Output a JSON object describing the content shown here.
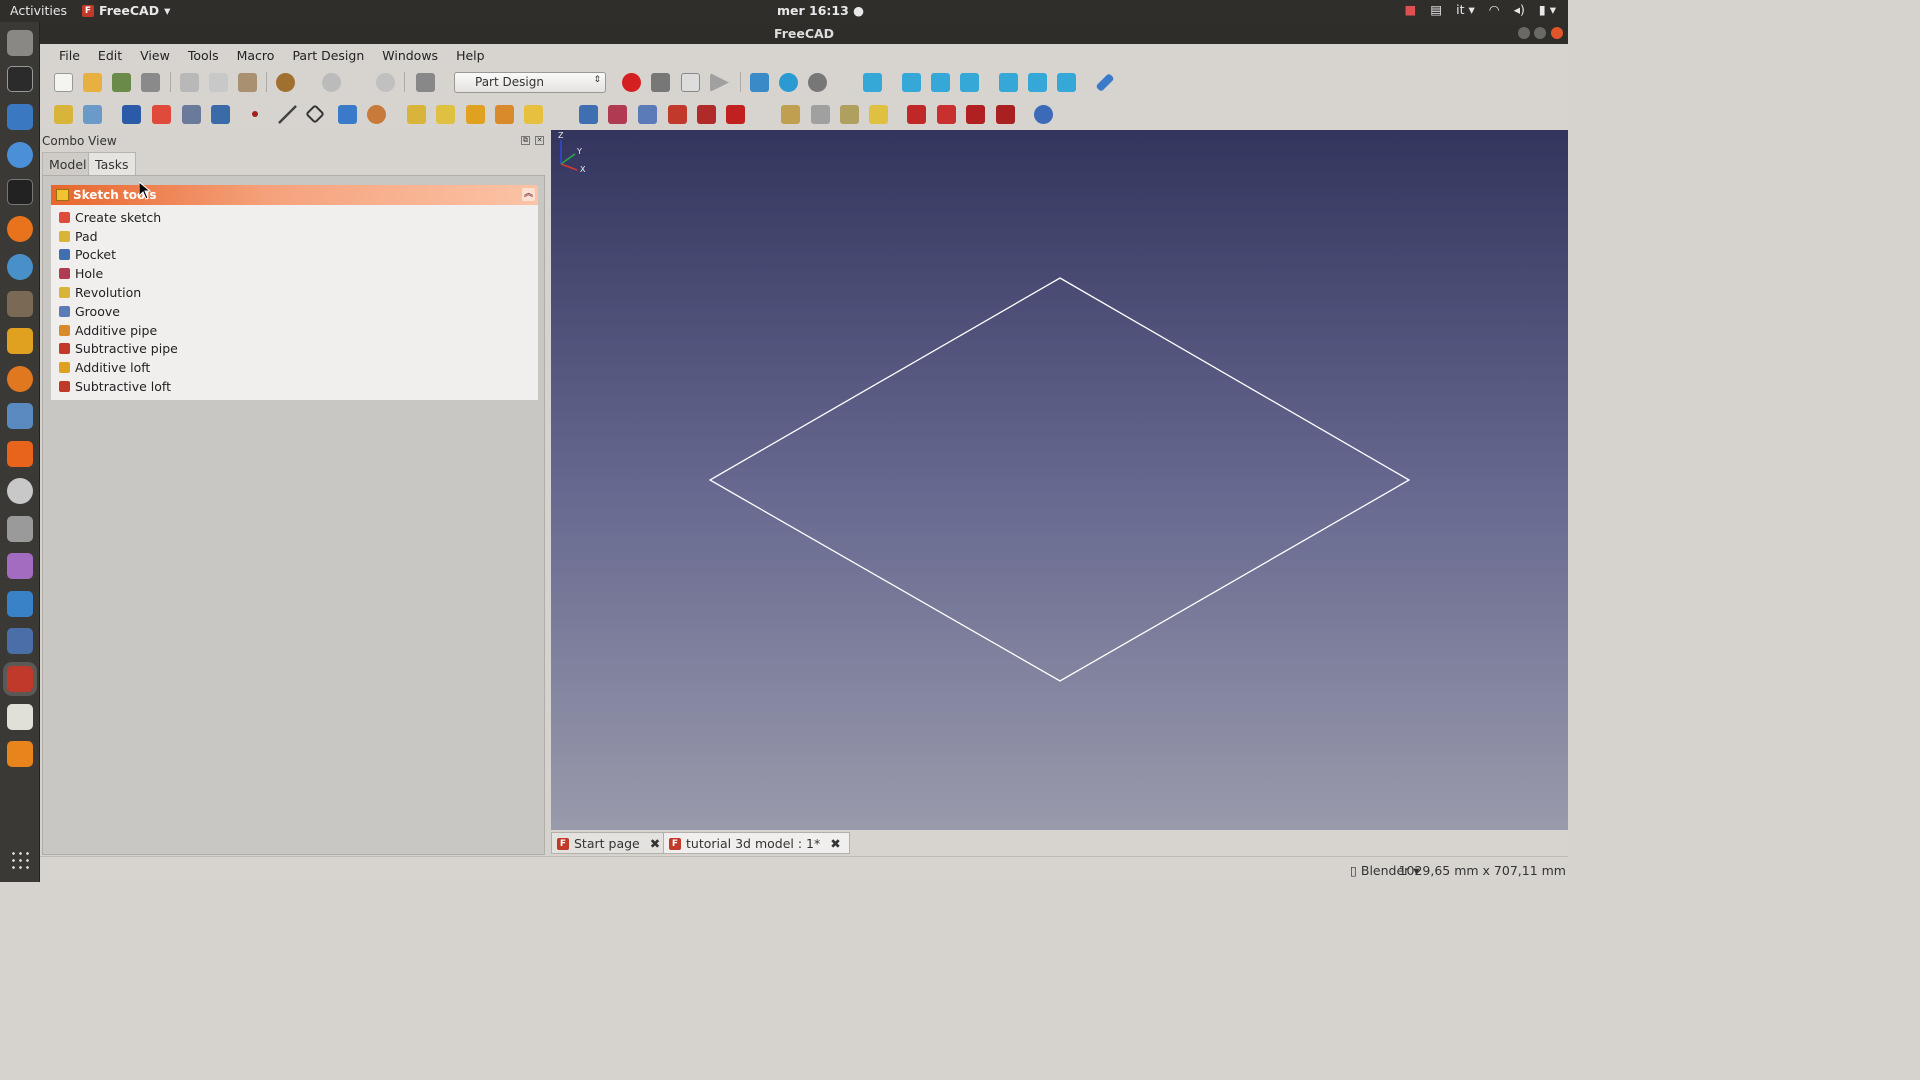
{
  "topbar": {
    "activities": "Activities",
    "app_name": "FreeCAD",
    "clock": "mer 16:13",
    "lang": "it"
  },
  "window": {
    "title": "FreeCAD"
  },
  "menu": [
    "File",
    "Edit",
    "View",
    "Tools",
    "Macro",
    "Part Design",
    "Windows",
    "Help"
  ],
  "workbench": {
    "selected": "Part Design"
  },
  "combo": {
    "title": "Combo View",
    "tabs": [
      "Model",
      "Tasks"
    ],
    "active_tab": "Tasks"
  },
  "task_panel": {
    "header": "Sketch tools",
    "items": [
      {
        "label": "Create sketch",
        "color": "#e04a3a"
      },
      {
        "label": "Pad",
        "color": "#d9b43a"
      },
      {
        "label": "Pocket",
        "color": "#3f6fb0"
      },
      {
        "label": "Hole",
        "color": "#b03a52"
      },
      {
        "label": "Revolution",
        "color": "#d9b43a"
      },
      {
        "label": "Groove",
        "color": "#5a7ab8"
      },
      {
        "label": "Additive pipe",
        "color": "#d98a2a"
      },
      {
        "label": "Subtractive pipe",
        "color": "#c0392b"
      },
      {
        "label": "Additive loft",
        "color": "#e0a020"
      },
      {
        "label": "Subtractive loft",
        "color": "#c0392b"
      }
    ]
  },
  "doc_tabs": [
    {
      "label": "Start page"
    },
    {
      "label": "tutorial 3d model : 1*"
    }
  ],
  "status": {
    "nav_style": "Blender",
    "dimensions": "1029,65 mm x 707,11 mm"
  },
  "axis": {
    "x": "X",
    "y": "Y",
    "z": "Z"
  }
}
